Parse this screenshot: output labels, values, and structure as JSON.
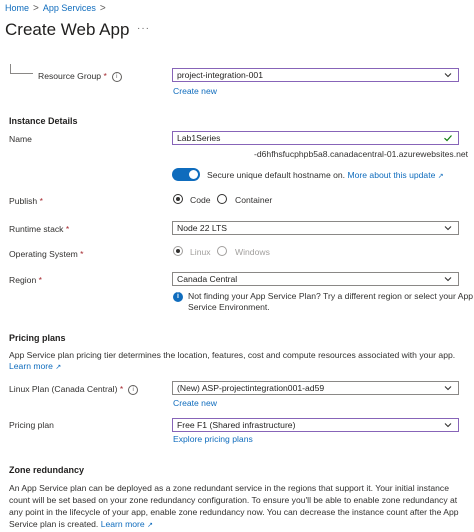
{
  "breadcrumb": {
    "home": "Home",
    "app_services": "App Services",
    "separator": ">"
  },
  "page": {
    "title": "Create Web App",
    "more": "···"
  },
  "resource_group": {
    "label": "Resource Group",
    "value": "project-integration-001",
    "create_new": "Create new"
  },
  "instance_details": {
    "heading": "Instance Details",
    "name_label": "Name",
    "name_value": "Lab1Series",
    "hostname_suffix": "-d6hfhsfucphpb5a8.canadacentral-01.azurewebsites.net",
    "toggle_label": "Secure unique default hostname on.",
    "toggle_link": "More about this update",
    "toggle_on": true
  },
  "publish": {
    "label": "Publish",
    "options": [
      "Code",
      "Container"
    ],
    "selected": "Code"
  },
  "runtime_stack": {
    "label": "Runtime stack",
    "value": "Node 22 LTS"
  },
  "operating_system": {
    "label": "Operating System",
    "options": [
      "Linux",
      "Windows"
    ],
    "selected": "Linux"
  },
  "region": {
    "label": "Region",
    "value": "Canada Central",
    "info_line1": "Not finding your App Service Plan? Try a different region or select your App",
    "info_line2": "Service Environment."
  },
  "pricing_plans": {
    "heading": "Pricing plans",
    "description": "App Service plan pricing tier determines the location, features, cost and compute resources associated with your app.",
    "learn_more": "Learn more",
    "linux_plan_label": "Linux Plan (Canada Central)",
    "linux_plan_value": "(New) ASP-projectintegration001-ad59",
    "create_new": "Create new",
    "pricing_plan_label": "Pricing plan",
    "pricing_plan_value": "Free F1 (Shared infrastructure)",
    "explore": "Explore pricing plans"
  },
  "zone_redundancy": {
    "heading": "Zone redundancy",
    "line1": "An App Service plan can be deployed as a zone redundant service in the regions that support it. Your initial instance",
    "line2": "count will be set based on your zone redundancy configuration. To ensure you'll be able to enable zone redundancy at",
    "line3": "any point in the lifecycle of your app, enable zone redundancy now. You can decrease the instance count after the App",
    "line4": "Service plan is created.",
    "learn_more": "Learn more"
  },
  "colors": {
    "link": "#0f6cbd",
    "required": "#a4262c",
    "focus_border": "#8764b8",
    "valid_check": "#107c10"
  }
}
